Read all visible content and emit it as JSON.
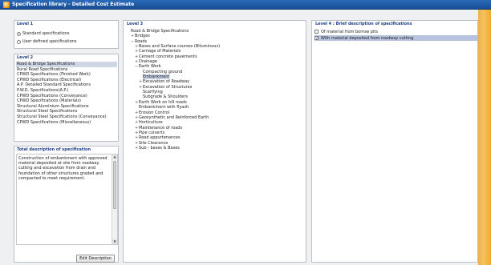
{
  "window": {
    "title": "Specification library - Detailed Cost Estimate"
  },
  "level1": {
    "label": "Level 1",
    "options": [
      {
        "label": "Standard specifications",
        "selected": true
      },
      {
        "label": "User defined specifications",
        "selected": false
      }
    ]
  },
  "level2": {
    "label": "Level 2",
    "items": [
      {
        "label": "Road & Bridge Specifications",
        "selected": true
      },
      {
        "label": "Rural Road Specifications",
        "selected": false
      },
      {
        "label": "CPWD Specifications (Finished Work)",
        "selected": false
      },
      {
        "label": "CPWD Specifications (Electrical)",
        "selected": false
      },
      {
        "label": "A.P. Detailed Standard Specifications",
        "selected": false
      },
      {
        "label": "P.W.D. Specifications(A.P.)",
        "selected": false
      },
      {
        "label": "CPWD Specifications (Conveyance)",
        "selected": false
      },
      {
        "label": "CPWD Specifications (Materials)",
        "selected": false
      },
      {
        "label": "Structural Aluminium Specifications",
        "selected": false
      },
      {
        "label": "Structural Steel Specifications",
        "selected": false
      },
      {
        "label": "Structural Steel Specifications (Conveyance)",
        "selected": false
      },
      {
        "label": "CPWD Specifications (Miscellaneous)",
        "selected": false
      }
    ]
  },
  "total_description": {
    "label": "Total description of specification",
    "text": "Construction of embankment with approved material deposited at site from roadway cutting and excavation from drain and foundation of other structures graded and compacted to meet requirement.",
    "edit_button": "Edit Description"
  },
  "level3": {
    "label": "Level 3",
    "tree": [
      {
        "label": "Road & Bridge Specifications",
        "depth": 0,
        "expander": "",
        "selected": false
      },
      {
        "label": "Bridges",
        "depth": 1,
        "expander": "+",
        "selected": false
      },
      {
        "label": "Roads",
        "depth": 1,
        "expander": "−",
        "selected": false
      },
      {
        "label": "Bases and Surface courses (Bituminous)",
        "depth": 2,
        "expander": "+",
        "selected": false
      },
      {
        "label": "Carriage of Materials",
        "depth": 2,
        "expander": "+",
        "selected": false
      },
      {
        "label": "Cement concrete pavements",
        "depth": 2,
        "expander": "+",
        "selected": false
      },
      {
        "label": "Drainage",
        "depth": 2,
        "expander": "+",
        "selected": false
      },
      {
        "label": "Earth Work",
        "depth": 2,
        "expander": "−",
        "selected": false
      },
      {
        "label": "Compacting ground",
        "depth": 3,
        "expander": "",
        "selected": false
      },
      {
        "label": "Embankment",
        "depth": 3,
        "expander": "",
        "selected": true
      },
      {
        "label": "Excavation of Roadway",
        "depth": 3,
        "expander": "+",
        "selected": false
      },
      {
        "label": "Excavation of Structures",
        "depth": 3,
        "expander": "+",
        "selected": false
      },
      {
        "label": "Scarifying",
        "depth": 3,
        "expander": "",
        "selected": false
      },
      {
        "label": "Subgrade & Shoulders",
        "depth": 3,
        "expander": "",
        "selected": false
      },
      {
        "label": "Earth Work on hill roads",
        "depth": 2,
        "expander": "+",
        "selected": false
      },
      {
        "label": "Embankment with flyash",
        "depth": 2,
        "expander": "",
        "selected": false
      },
      {
        "label": "Erosion Control",
        "depth": 2,
        "expander": "+",
        "selected": false
      },
      {
        "label": "Geosynthetic and Reinforced Earth",
        "depth": 2,
        "expander": "+",
        "selected": false
      },
      {
        "label": "Horticulture",
        "depth": 2,
        "expander": "+",
        "selected": false
      },
      {
        "label": "Maintenance of roads",
        "depth": 2,
        "expander": "+",
        "selected": false
      },
      {
        "label": "Pipe culverts",
        "depth": 2,
        "expander": "+",
        "selected": false
      },
      {
        "label": "Road appurtenances",
        "depth": 2,
        "expander": "+",
        "selected": false
      },
      {
        "label": "Site Clearance",
        "depth": 2,
        "expander": "+",
        "selected": false
      },
      {
        "label": "Sub - bases & Bases",
        "depth": 2,
        "expander": "+",
        "selected": false
      }
    ]
  },
  "level4": {
    "label": "Level 4 : Brief description of specifications",
    "items": [
      {
        "label": "Of material from borrow pits",
        "checked": false,
        "selected": false
      },
      {
        "label": "With material deposited from roadway cutting",
        "checked": true,
        "selected": true
      }
    ]
  },
  "colors": {
    "accent": "#1b3f8a",
    "titlebar": "#2a69b8",
    "selection": "#cfd6e6"
  }
}
